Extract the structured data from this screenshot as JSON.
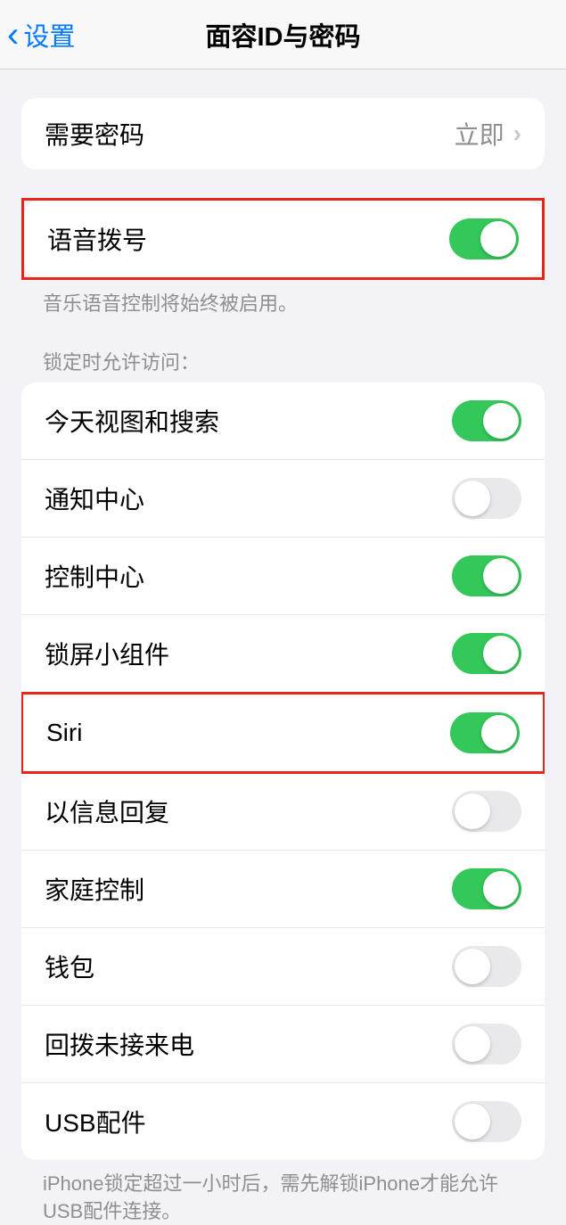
{
  "nav": {
    "back_label": "设置",
    "title": "面容ID与密码"
  },
  "require_passcode": {
    "label": "需要密码",
    "value": "立即"
  },
  "voice_dial": {
    "label": "语音拨号",
    "footer": "音乐语音控制将始终被启用。"
  },
  "allow_access": {
    "header": "锁定时允许访问：",
    "items": [
      {
        "label": "今天视图和搜索",
        "on": true
      },
      {
        "label": "通知中心",
        "on": false
      },
      {
        "label": "控制中心",
        "on": true
      },
      {
        "label": "锁屏小组件",
        "on": true
      },
      {
        "label": "Siri",
        "on": true
      },
      {
        "label": "以信息回复",
        "on": false
      },
      {
        "label": "家庭控制",
        "on": true
      },
      {
        "label": "钱包",
        "on": false
      },
      {
        "label": "回拨未接来电",
        "on": false
      },
      {
        "label": "USB配件",
        "on": false
      }
    ],
    "footer": "iPhone锁定超过一小时后，需先解锁iPhone才能允许USB配件连接。"
  }
}
